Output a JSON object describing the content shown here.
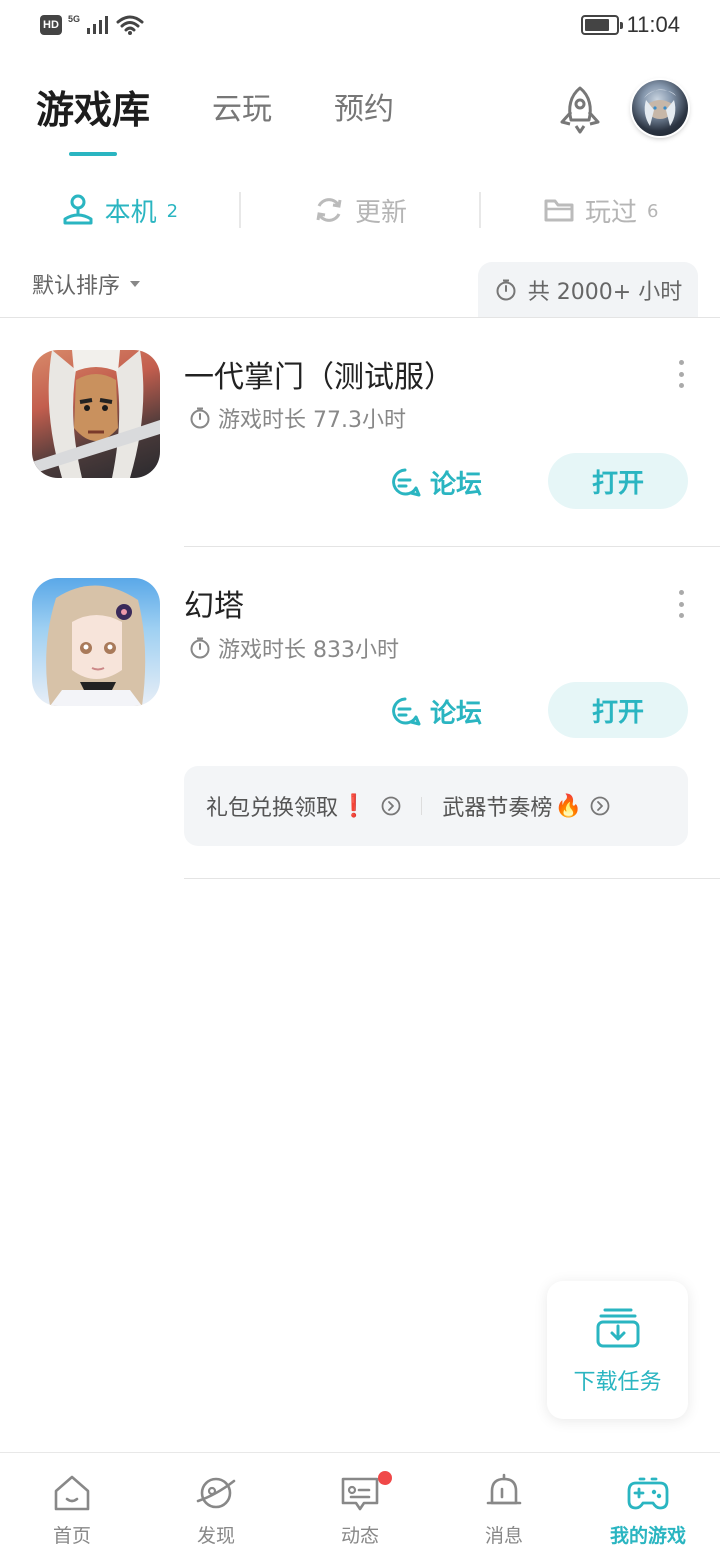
{
  "status_bar": {
    "hd": "HD",
    "network": "5G",
    "time": "11:04",
    "battery_level": 0.8
  },
  "top_tabs": [
    {
      "label": "游戏库",
      "active": true
    },
    {
      "label": "云玩",
      "active": false
    },
    {
      "label": "预约",
      "active": false
    }
  ],
  "sub_tabs": [
    {
      "label": "本机",
      "count": "2",
      "icon": "device-icon",
      "active": true
    },
    {
      "label": "更新",
      "count": "",
      "icon": "refresh-icon",
      "active": false
    },
    {
      "label": "玩过",
      "count": "6",
      "icon": "folder-icon",
      "active": false
    }
  ],
  "sort": {
    "label": "默认排序"
  },
  "total_time": {
    "label": "共 2000+ 小时"
  },
  "games": [
    {
      "title": "一代掌门（测试服）",
      "play_time": "游戏时长 77.3小时",
      "forum_label": "论坛",
      "open_label": "打开"
    },
    {
      "title": "幻塔",
      "play_time": "游戏时长 833小时",
      "forum_label": "论坛",
      "open_label": "打开"
    }
  ],
  "extras": [
    {
      "label": "礼包兑换领取",
      "emoji": "❗"
    },
    {
      "label": "武器节奏榜",
      "emoji": "🔥"
    }
  ],
  "download": {
    "label": "下载任务"
  },
  "bottom_nav": [
    {
      "label": "首页",
      "icon": "home-icon"
    },
    {
      "label": "发现",
      "icon": "planet-icon"
    },
    {
      "label": "动态",
      "icon": "chat-icon",
      "has_badge": true
    },
    {
      "label": "消息",
      "icon": "bell-icon"
    },
    {
      "label": "我的游戏",
      "icon": "gamepad-icon",
      "active": true
    }
  ],
  "colors": {
    "accent": "#2ab5c1",
    "open_bg": "#e6f6f7",
    "badge": "#f04848"
  }
}
